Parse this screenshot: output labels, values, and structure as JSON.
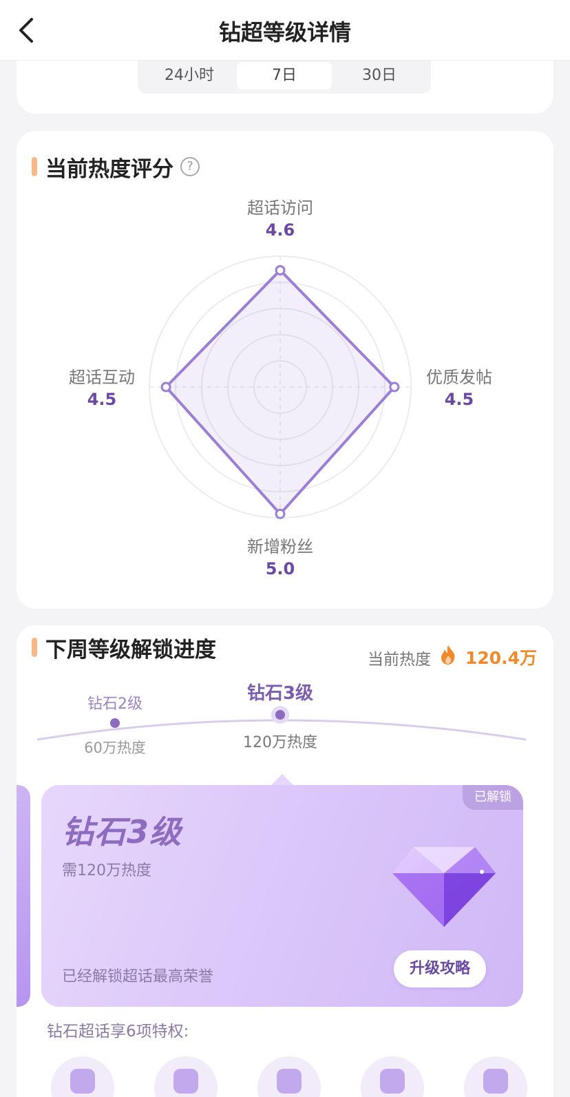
{
  "header": {
    "title": "钻超等级详情"
  },
  "time_tabs": [
    {
      "label": "24小时",
      "active": false
    },
    {
      "label": "7日",
      "active": true
    },
    {
      "label": "30日",
      "active": false
    }
  ],
  "heat_score": {
    "title": "当前热度评分",
    "help": "?",
    "axes": [
      {
        "label": "超话访问",
        "value": "4.6"
      },
      {
        "label": "优质发帖",
        "value": "4.5"
      },
      {
        "label": "新增粉丝",
        "value": "5.0"
      },
      {
        "label": "超话互动",
        "value": "4.5"
      }
    ],
    "accent": "#9b7fd4"
  },
  "progress": {
    "title": "下周等级解锁进度",
    "current_heat_label": "当前热度",
    "current_heat_value": "120.4万",
    "levels": [
      {
        "name": "钻石2级",
        "req": "60万热度"
      },
      {
        "name": "钻石3级",
        "req": "120万热度"
      }
    ],
    "card": {
      "badge": "已解锁",
      "level": "钻石3级",
      "need": "需120万热度",
      "desc": "已经解锁超话最高荣誉",
      "button": "升级攻略"
    },
    "privilege_text": "钻石超话享6项特权:"
  }
}
